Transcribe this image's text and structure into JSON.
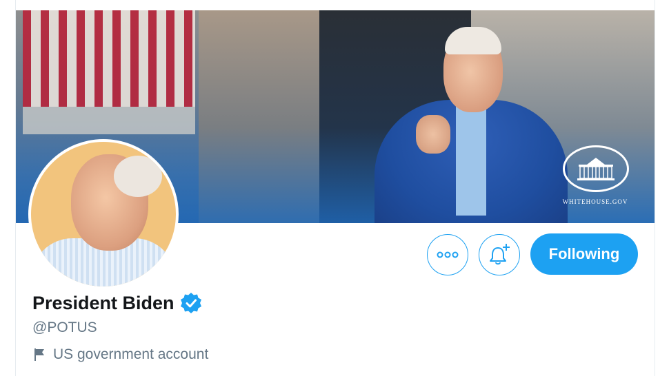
{
  "profile": {
    "display_name": "President Biden",
    "handle": "@POTUS",
    "category": "US government account",
    "verified": true,
    "verified_icon": "verified-badge-icon"
  },
  "banner": {
    "brand_text": "WHITEHOUSE.GOV",
    "logo_icon": "white-house-icon"
  },
  "actions": {
    "more_icon": "more-options-icon",
    "notify_icon": "bell-plus-icon",
    "follow_label": "Following"
  },
  "colors": {
    "accent": "#1da1f2",
    "name_text": "#14171a",
    "secondary_text": "#657786",
    "banner_blue": "#1d6ec0",
    "avatar_bg": "#f2c47d"
  }
}
